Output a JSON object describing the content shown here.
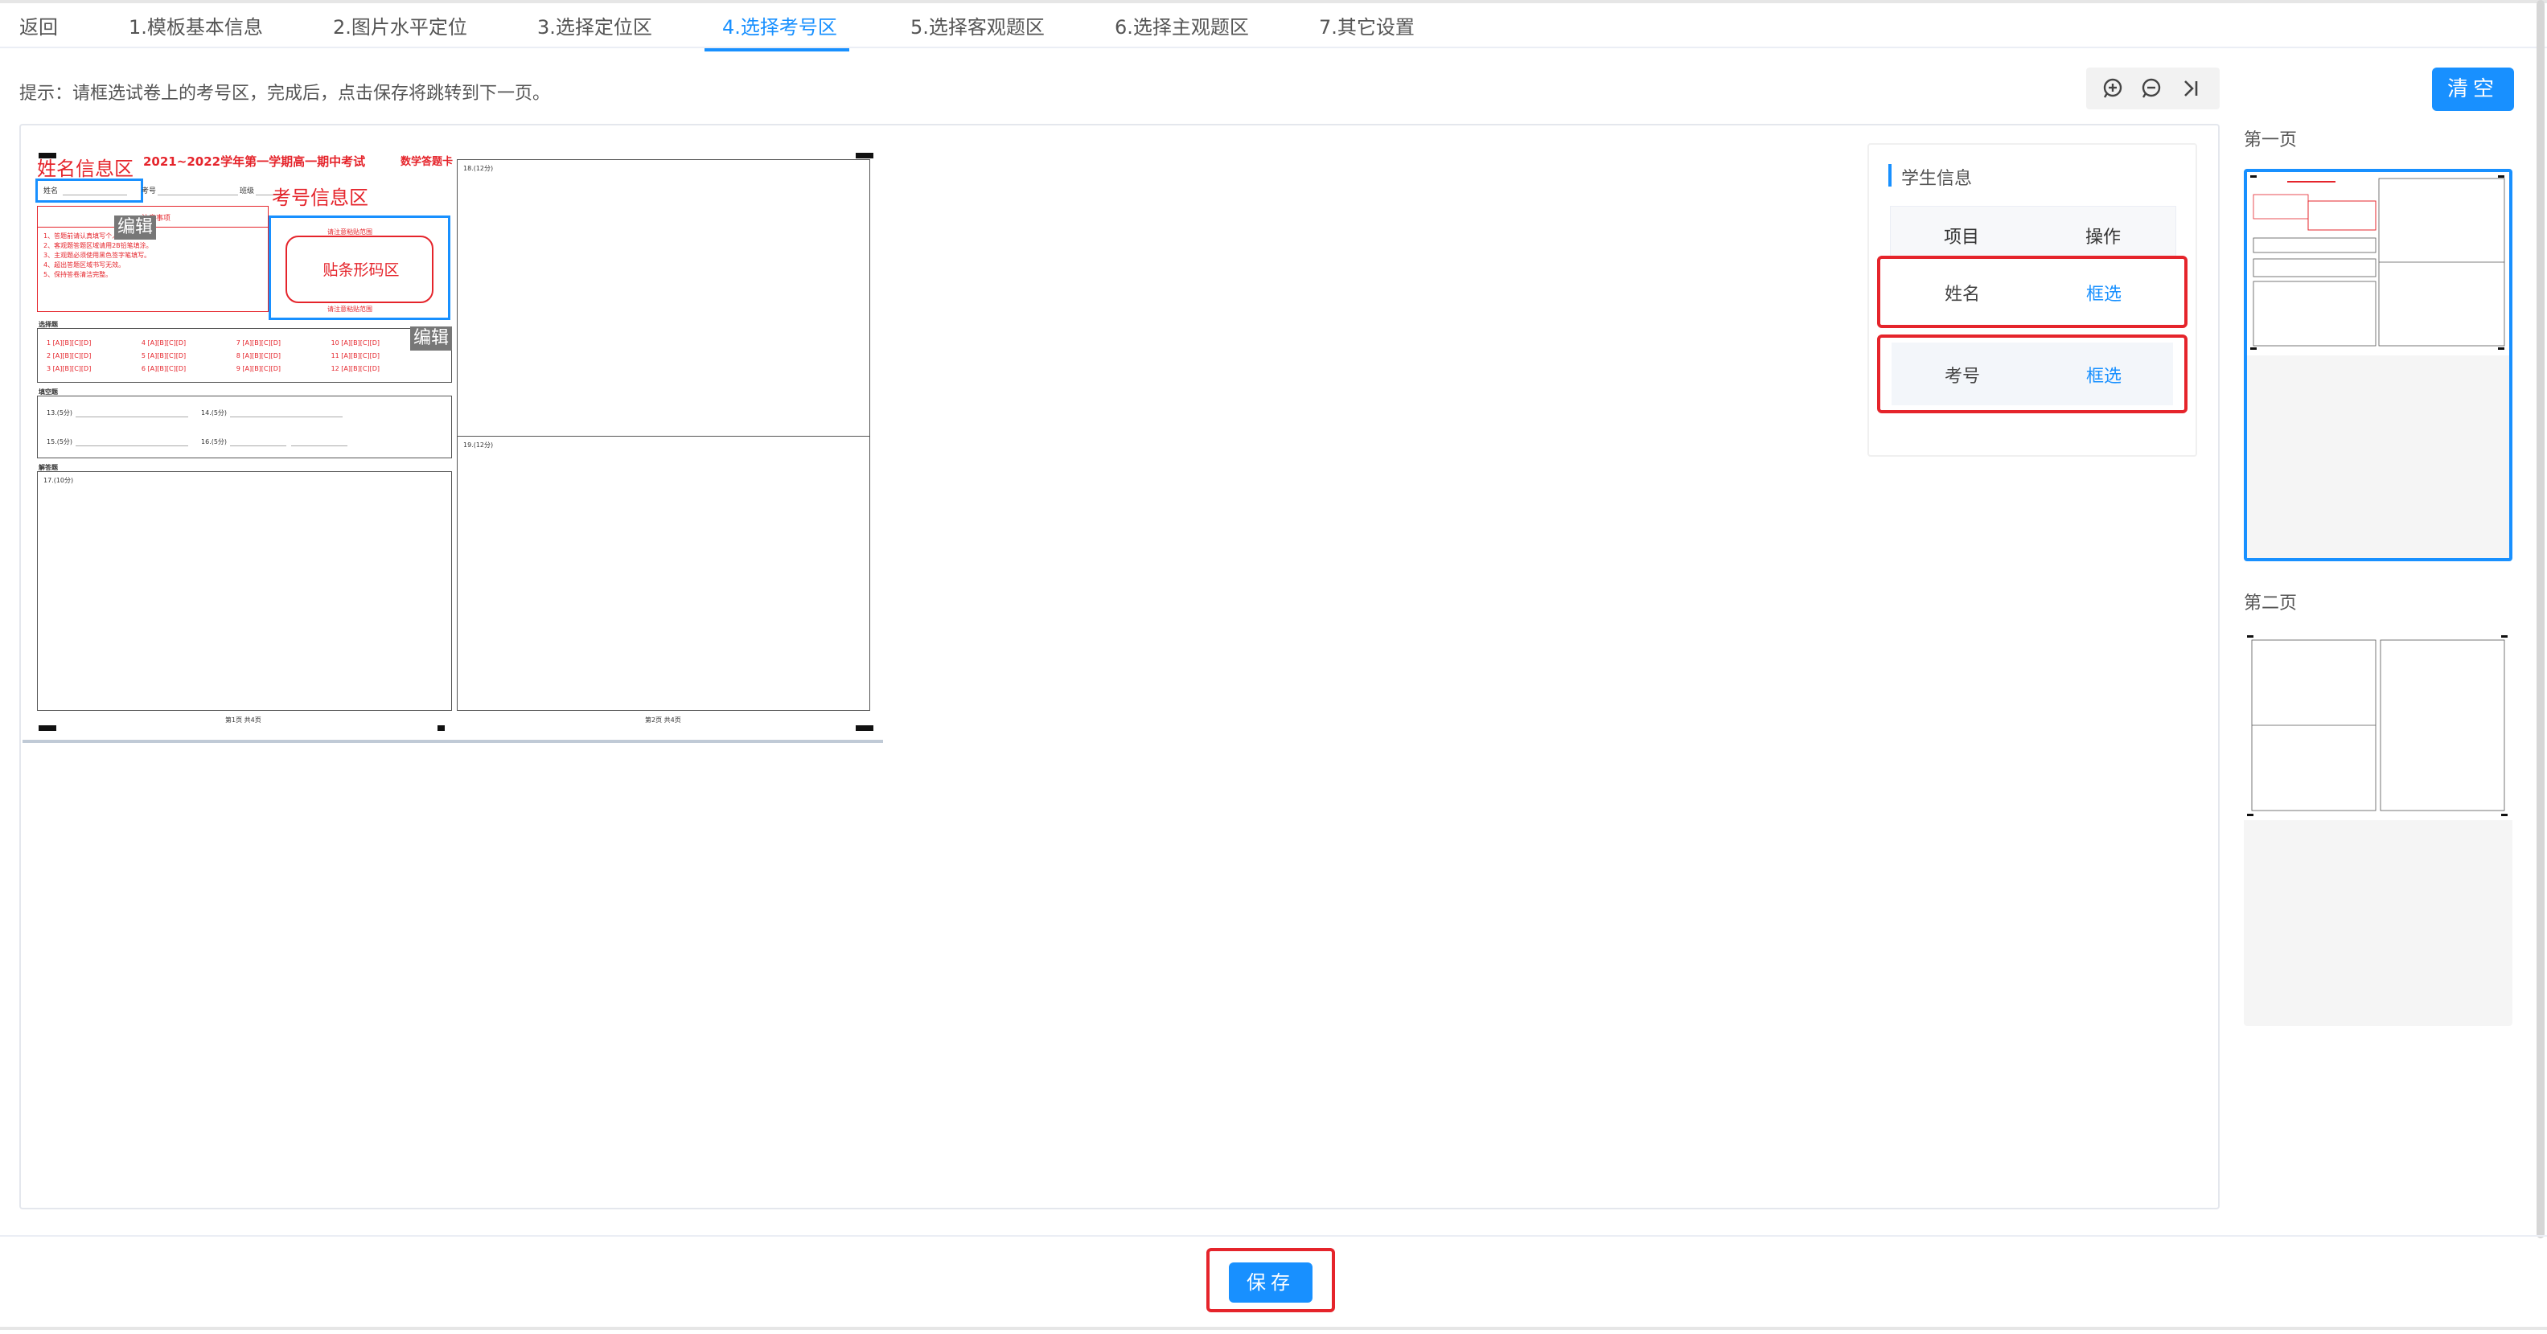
{
  "tabs": [
    {
      "label": "返回",
      "active": false
    },
    {
      "label": "1.模板基本信息",
      "active": false
    },
    {
      "label": "2.图片水平定位",
      "active": false
    },
    {
      "label": "3.选择定位区",
      "active": false
    },
    {
      "label": "4.选择考号区",
      "active": true
    },
    {
      "label": "5.选择客观题区",
      "active": false
    },
    {
      "label": "6.选择主观题区",
      "active": false
    },
    {
      "label": "7.其它设置",
      "active": false
    }
  ],
  "hint": "提示：请框选试卷上的考号区，完成后，点击保存将跳转到下一页。",
  "toolbar": {
    "zoom_in_icon": "zoom-in-icon",
    "zoom_out_icon": "zoom-out-icon",
    "next_icon": "skip-next-icon"
  },
  "clear_button": "清空",
  "sheet": {
    "title": "2021~2022学年第一学期高一期中考试",
    "subtitle": "数学答题卡",
    "name_label": "姓名",
    "exam_no_label": "考号",
    "class_label": "班级",
    "notice_title": "注意事项",
    "notice_items": [
      "1、答题前请认真填写个人信息。",
      "2、客观题答题区域请用2B铅笔填涂。",
      "3、主观题必须使用黑色签字笔填写。",
      "4、超出答题区域书写无效。",
      "5、保持答卷清洁完整。"
    ],
    "barcode_top": "请注意粘贴范围",
    "barcode_text": "贴条形码区",
    "barcode_bottom": "请注意粘贴范围",
    "choice_section": "选择题",
    "choice_rows": [
      [
        "1 [A][B][C][D]",
        "4 [A][B][C][D]",
        "7 [A][B][C][D]",
        "10 [A][B][C][D]"
      ],
      [
        "2 [A][B][C][D]",
        "5 [A][B][C][D]",
        "8 [A][B][C][D]",
        "11 [A][B][C][D]"
      ],
      [
        "3 [A][B][C][D]",
        "6 [A][B][C][D]",
        "9 [A][B][C][D]",
        "12 [A][B][C][D]"
      ]
    ],
    "fill_section": "填空题",
    "fill_items": [
      "13.(5分)",
      "14.(5分)",
      "15.(5分)",
      "16.(5分)"
    ],
    "answer_section": "解答题",
    "q17": "17.(10分)",
    "q18": "18.(12分)",
    "q19": "19.(12分)",
    "footer_left": "第1页 共4页",
    "footer_right": "第2页 共4页",
    "name_area_label": "姓名信息区",
    "exam_area_label": "考号信息区",
    "edit_label_1": "编辑",
    "edit_label_2": "编辑"
  },
  "student_info": {
    "title": "学生信息",
    "col_item": "项目",
    "col_action": "操作",
    "rows": [
      {
        "item": "姓名",
        "action": "框选"
      },
      {
        "item": "考号",
        "action": "框选"
      }
    ]
  },
  "pages": [
    {
      "label": "第一页",
      "selected": true
    },
    {
      "label": "第二页",
      "selected": false
    }
  ],
  "save_button": "保存",
  "colors": {
    "accent": "#1890ff",
    "highlight": "#e5242b"
  }
}
